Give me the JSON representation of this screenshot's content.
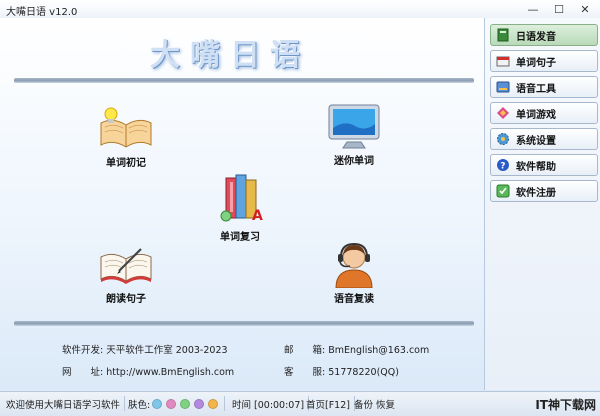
{
  "window": {
    "title": "大嘴日语 v12.0",
    "minimize": "—",
    "maximize": "☐",
    "close": "✕"
  },
  "app_title": "大嘴日语",
  "features": [
    {
      "label": "单词初记",
      "icon": "open-book-bulb-icon"
    },
    {
      "label": "迷你单词",
      "icon": "monitor-icon"
    },
    {
      "label": "单词复习",
      "icon": "books-stack-icon"
    },
    {
      "label": "朗读句子",
      "icon": "open-book-pen-icon"
    },
    {
      "label": "语音复读",
      "icon": "headset-person-icon"
    }
  ],
  "info": {
    "dev_label": "软件开发:",
    "dev_value": "天平软件工作室 2003-2023",
    "email_label": "邮　　箱:",
    "email_value": "BmEnglish@163.com",
    "site_label": "网　　址:",
    "site_value": "http://www.BmEnglish.com",
    "service_label": "客　　服:",
    "service_value": "51778220(QQ)"
  },
  "sidebar": [
    {
      "label": "日语发音",
      "icon": "pronunciation-book-icon",
      "active": true
    },
    {
      "label": "单词句子",
      "icon": "word-sentence-icon"
    },
    {
      "label": "语音工具",
      "icon": "voice-tool-icon"
    },
    {
      "label": "单词游戏",
      "icon": "word-game-icon"
    },
    {
      "label": "系统设置",
      "icon": "settings-gear-icon"
    },
    {
      "label": "软件帮助",
      "icon": "help-icon"
    },
    {
      "label": "软件注册",
      "icon": "register-icon"
    }
  ],
  "status": {
    "welcome": "欢迎使用大嘴日语学习软件",
    "skin_label": "肤色:",
    "skin_colors": [
      "#7ec7e8",
      "#e28ac0",
      "#7fd27f",
      "#b489e0",
      "#f2b54a"
    ],
    "time_label": "时间 [00:00:07]",
    "home_label": "首页[F12]",
    "backup_label": "备份",
    "restore_label": "恢复"
  },
  "watermark": "IT神下载网"
}
